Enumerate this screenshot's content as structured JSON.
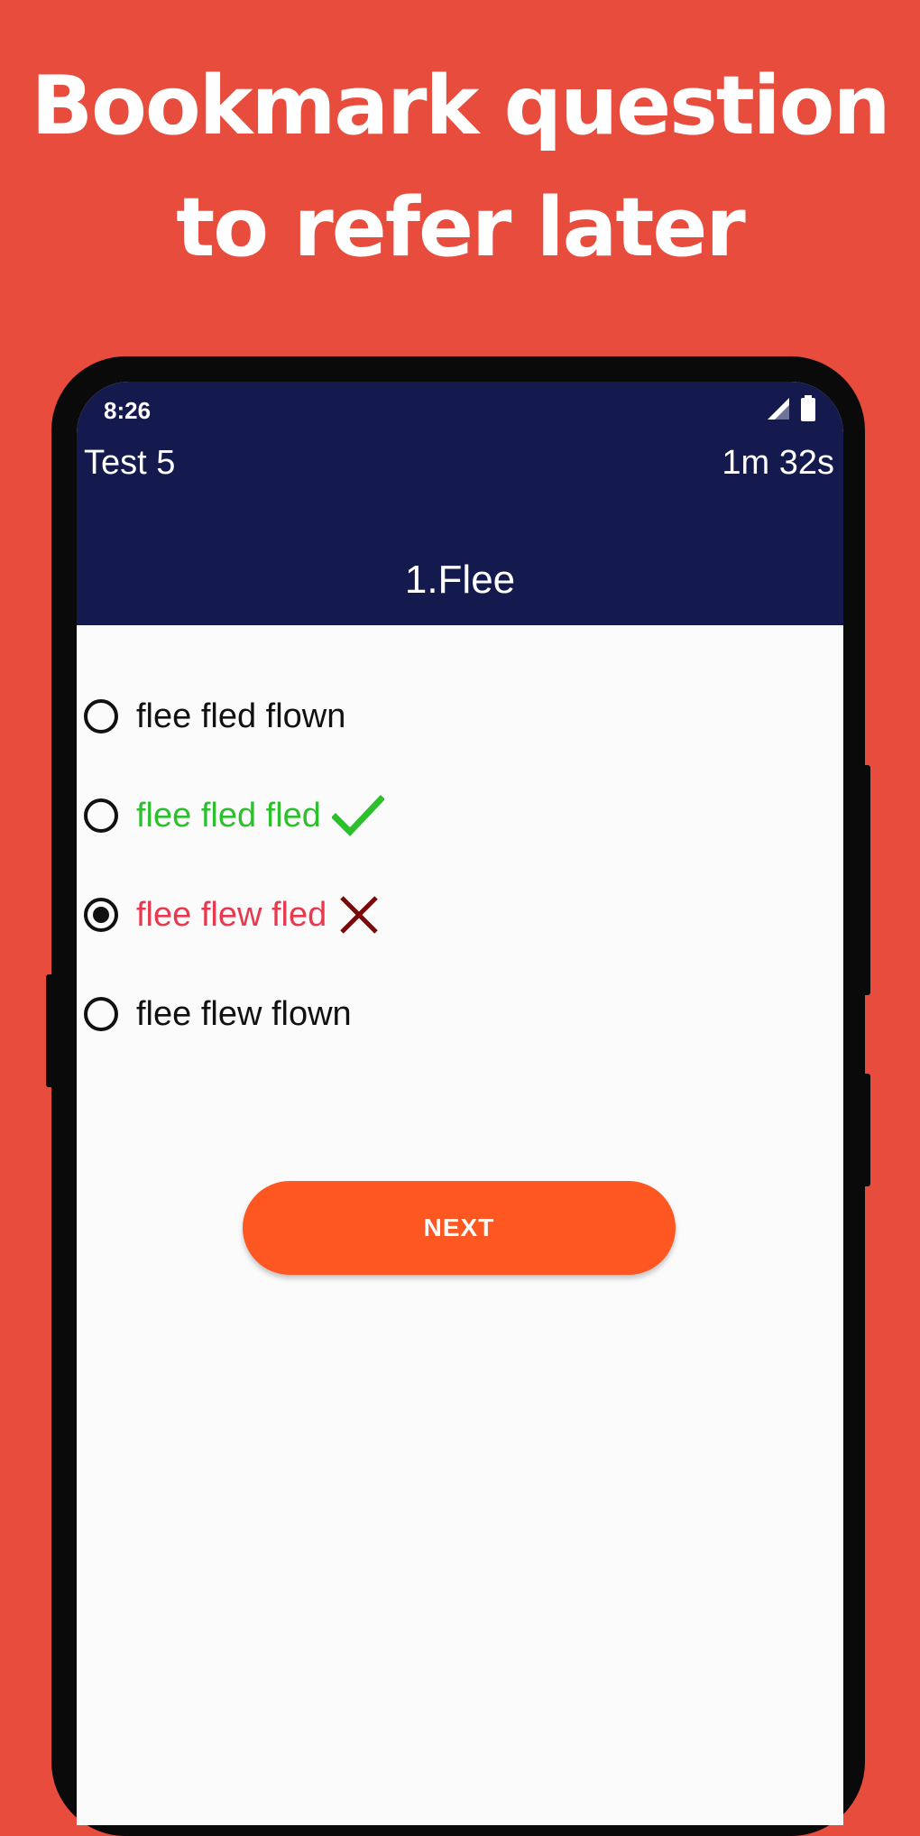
{
  "headline": {
    "line1": "Bookmark question",
    "line2": "to refer later"
  },
  "status_bar": {
    "time": "8:26",
    "icons": [
      "signal-icon",
      "battery-icon"
    ]
  },
  "app_bar": {
    "title": "Test 5",
    "timer": "1m 32s",
    "question": "1.Flee"
  },
  "options": [
    {
      "label": "flee fled flown",
      "state": "default",
      "selected": false
    },
    {
      "label": "flee fled fled",
      "state": "correct",
      "selected": false,
      "icon": "check-icon"
    },
    {
      "label": "flee flew fled",
      "state": "wrong",
      "selected": true,
      "icon": "cross-icon"
    },
    {
      "label": "flee flew flown",
      "state": "default",
      "selected": false
    }
  ],
  "next_button": {
    "label": "NEXT"
  },
  "colors": {
    "background": "#E74C3C",
    "app_bar": "#141A4D",
    "correct": "#2EBF2E",
    "wrong": "#E8394E",
    "cross_icon": "#7A0A0A",
    "button": "#FF5722"
  }
}
